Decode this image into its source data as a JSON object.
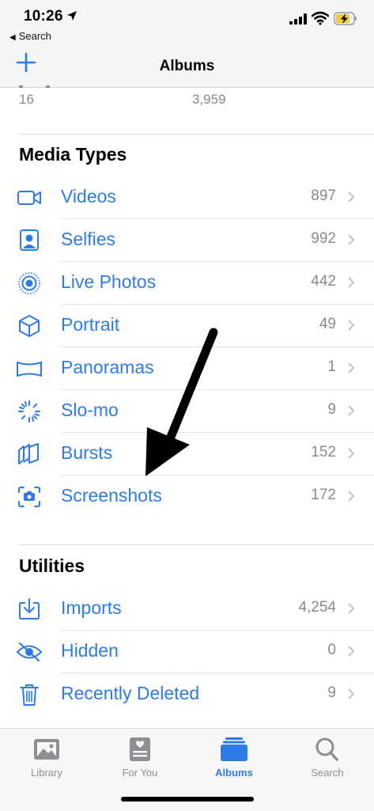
{
  "status": {
    "time": "10:26",
    "back_label": "Search"
  },
  "nav": {
    "title": "Albums",
    "add_icon": "plus-icon"
  },
  "top_counts": [
    "16",
    "3,959"
  ],
  "media_types": {
    "title": "Media Types",
    "items": [
      {
        "label": "Videos",
        "count": "897",
        "icon": "video-icon"
      },
      {
        "label": "Selfies",
        "count": "992",
        "icon": "selfie-icon"
      },
      {
        "label": "Live Photos",
        "count": "442",
        "icon": "live-photo-icon"
      },
      {
        "label": "Portrait",
        "count": "49",
        "icon": "cube-icon"
      },
      {
        "label": "Panoramas",
        "count": "1",
        "icon": "panorama-icon"
      },
      {
        "label": "Slo-mo",
        "count": "9",
        "icon": "slomo-icon"
      },
      {
        "label": "Bursts",
        "count": "152",
        "icon": "bursts-icon"
      },
      {
        "label": "Screenshots",
        "count": "172",
        "icon": "screenshot-icon"
      }
    ]
  },
  "utilities": {
    "title": "Utilities",
    "items": [
      {
        "label": "Imports",
        "count": "4,254",
        "icon": "import-icon"
      },
      {
        "label": "Hidden",
        "count": "0",
        "icon": "eye-slash-icon"
      },
      {
        "label": "Recently Deleted",
        "count": "9",
        "icon": "trash-icon"
      }
    ]
  },
  "tabs": [
    {
      "label": "Library",
      "icon": "library-icon"
    },
    {
      "label": "For You",
      "icon": "for-you-icon"
    },
    {
      "label": "Albums",
      "icon": "albums-icon",
      "active": true
    },
    {
      "label": "Search",
      "icon": "search-icon"
    }
  ],
  "colors": {
    "accent": "#2f7be5",
    "secondary_text": "#8a8a8e"
  }
}
